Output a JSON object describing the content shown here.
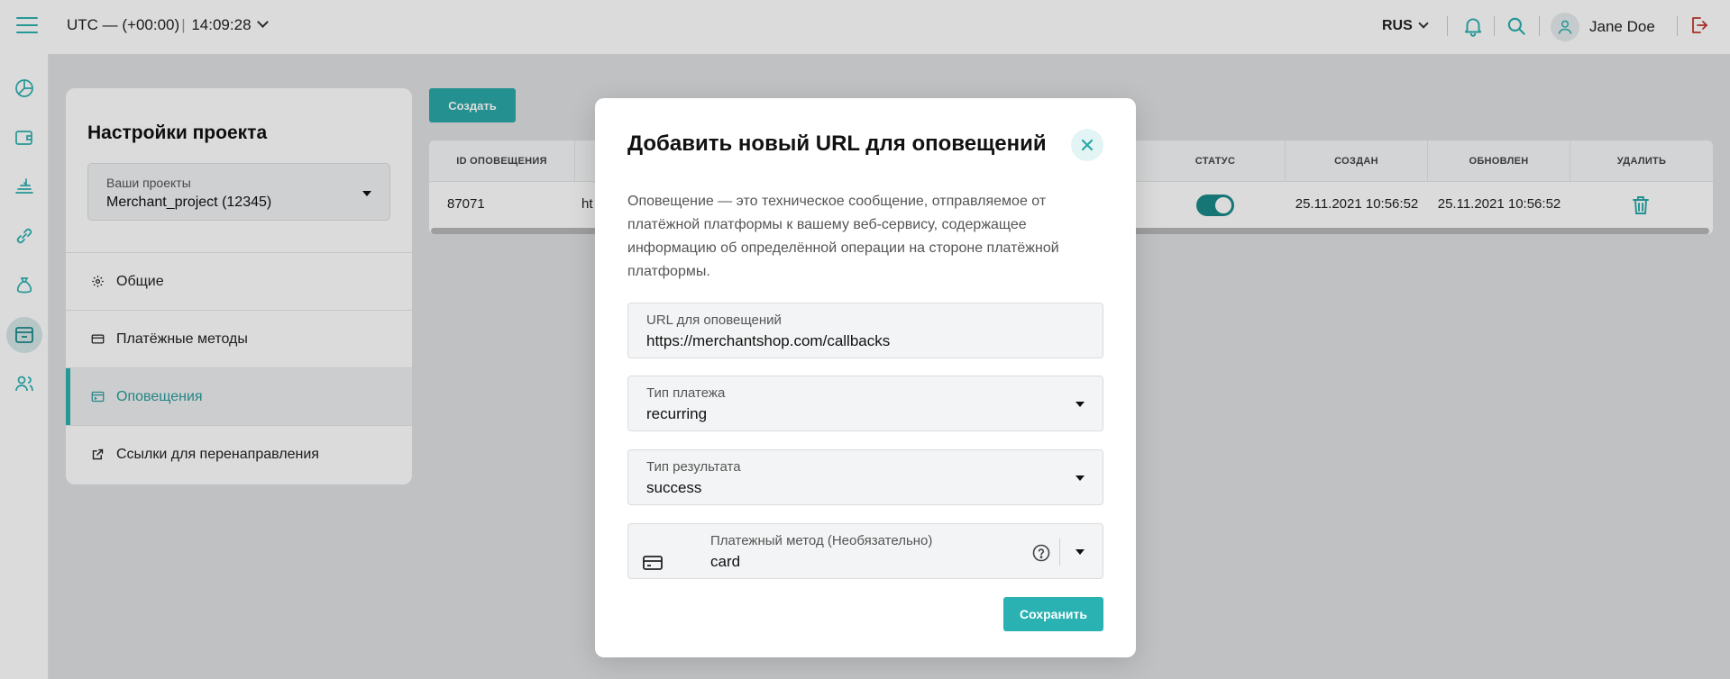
{
  "topbar": {
    "timezone": "UTC — (+00:00)",
    "time": "14:09:28",
    "language": "RUS",
    "user_name": "Jane Doe"
  },
  "settings": {
    "title": "Настройки проекта",
    "project_select": {
      "label": "Ваши проекты",
      "value": "Merchant_project (12345)"
    },
    "nav": [
      {
        "label": "Общие",
        "icon": "gear-icon"
      },
      {
        "label": "Платёжные методы",
        "icon": "wallet-icon"
      },
      {
        "label": "Оповещения",
        "icon": "notification-icon",
        "active": true
      },
      {
        "label": "Ссылки для перенаправления",
        "icon": "external-link-icon"
      }
    ]
  },
  "main": {
    "create_label": "Создать",
    "table": {
      "headers": [
        "ID ОПОВЕЩЕНИЯ",
        "СТАТУС",
        "СОЗДАН",
        "ОБНОВЛЕН",
        "УДАЛИТЬ"
      ],
      "rows": [
        {
          "id": "87071",
          "url_partial": "ht",
          "status_on": true,
          "created": "25.11.2021 10:56:52",
          "updated": "25.11.2021 10:56:52"
        }
      ]
    }
  },
  "modal": {
    "title": "Добавить новый URL для оповещений",
    "description": "Оповещение — это техническое сообщение, отправляемое от платёжной платформы к вашему веб-сервису, содержащее информацию об определённой операции на стороне платёжной платформы.",
    "fields": {
      "url": {
        "label": "URL для оповещений",
        "value": "https://merchantshop.com/callbacks"
      },
      "payment_type": {
        "label": "Тип платежа",
        "value": "recurring"
      },
      "result_type": {
        "label": "Тип результата",
        "value": "success"
      },
      "payment_method": {
        "label": "Платежный метод (Необязательно)",
        "value": "card"
      }
    },
    "save_label": "Сохранить"
  },
  "colors": {
    "accent": "#2cb0b0",
    "accent_dark": "#1a8a8a",
    "logout": "#c0392b"
  }
}
